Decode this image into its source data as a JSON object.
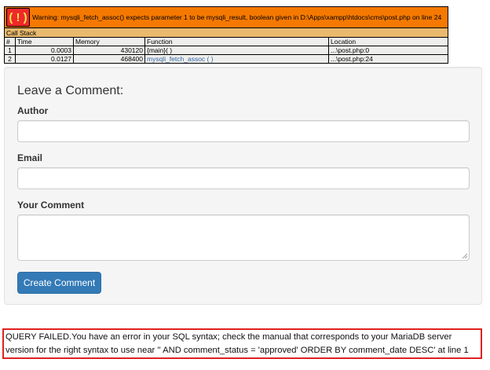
{
  "xdebug": {
    "badge": "( ! )",
    "warning": "Warning: mysqli_fetch_assoc() expects parameter 1 to be mysqli_result, boolean given in D:\\Apps\\xampp\\htdocs\\cms\\post.php on line 24",
    "call_stack_label": "Call Stack",
    "columns": [
      "#",
      "Time",
      "Memory",
      "Function",
      "Location"
    ],
    "rows": [
      {
        "num": "1",
        "time": "0.0003",
        "memory": "430120",
        "function": "{main}( )",
        "location": "...\\post.php:0"
      },
      {
        "num": "2",
        "time": "0.0127",
        "memory": "468400",
        "function": "mysqli_fetch_assoc ( )",
        "location": "...\\post.php:24"
      }
    ]
  },
  "form": {
    "title": "Leave a Comment:",
    "author_label": "Author",
    "author_value": "",
    "email_label": "Email",
    "email_value": "",
    "comment_label": "Your Comment",
    "comment_value": "",
    "submit_label": "Create Comment"
  },
  "error": {
    "line1": "QUERY FAILED.You have an error in your SQL syntax; check the manual that corresponds to your MariaDB server",
    "line2": "version for the right syntax to use near '' AND comment_status = 'approved' ORDER BY comment_date DESC' at line 1",
    "border_color": "#e02020"
  },
  "colors": {
    "warning_bg": "#f57900",
    "callstack_bg": "#e9b96e",
    "table_bg": "#eeeeec",
    "button_bg": "#337ab7"
  }
}
